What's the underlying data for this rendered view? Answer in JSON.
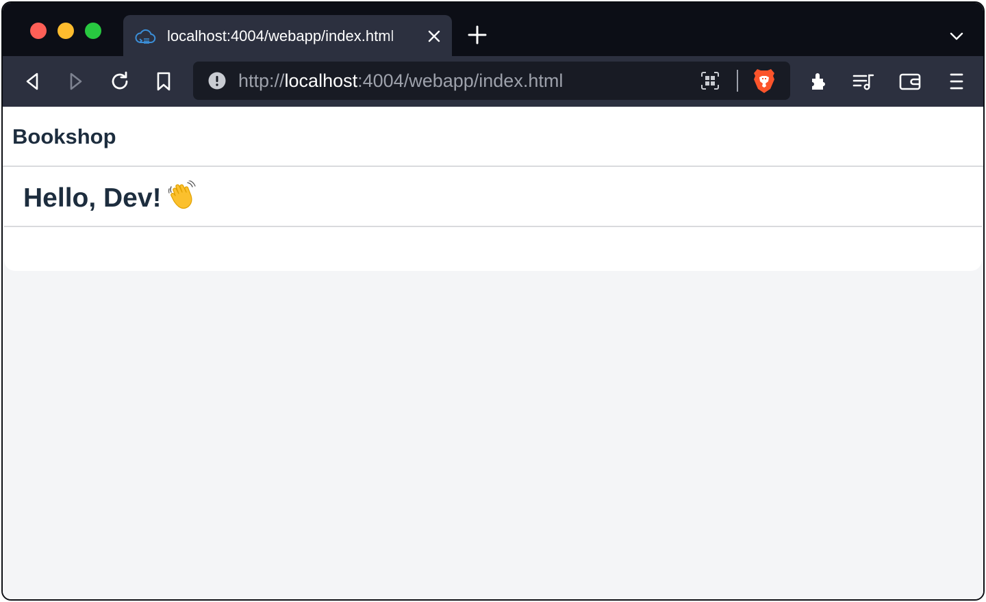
{
  "browser": {
    "tab": {
      "title": "localhost:4004/webapp/index.html",
      "favicon": "cloud-code-icon"
    },
    "address_bar": {
      "scheme": "http://",
      "host": "localhost",
      "rest": ":4004/webapp/index.html"
    },
    "toolbar_icons": [
      "back-icon",
      "forward-icon",
      "reload-icon",
      "bookmark-icon",
      "info-icon",
      "qr-code-icon",
      "brave-shields-icon",
      "extensions-icon",
      "playlist-icon",
      "wallet-icon",
      "menu-icon"
    ],
    "colors": {
      "tab_strip": "#0c0e16",
      "toolbar": "#2c303f",
      "url_field": "#181b24",
      "brave_orange": "#fb542b"
    }
  },
  "app": {
    "title": "Bookshop",
    "greeting": "Hello, Dev!",
    "greeting_emoji": "waving-hand-icon",
    "colors": {
      "text": "#1d2d3e",
      "background": "#f4f5f7",
      "surface": "#ffffff"
    }
  }
}
